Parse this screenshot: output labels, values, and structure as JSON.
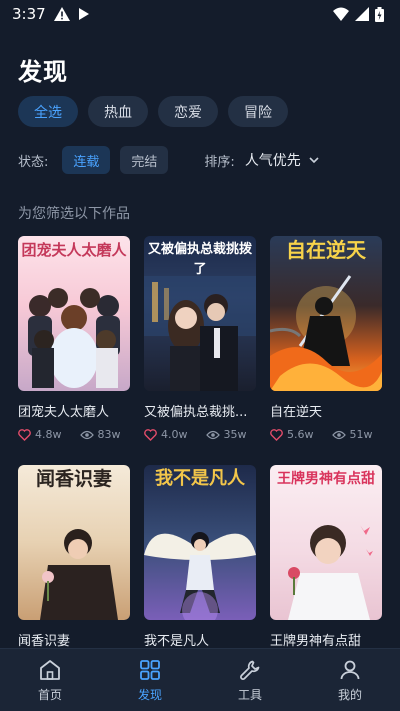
{
  "status_bar": {
    "time": "3:37"
  },
  "page": {
    "title": "发现"
  },
  "category_chips": [
    {
      "label": "全选",
      "active": true
    },
    {
      "label": "热血",
      "active": false
    },
    {
      "label": "恋爱",
      "active": false
    },
    {
      "label": "冒险",
      "active": false
    }
  ],
  "filters": {
    "status_label": "状态:",
    "status_options": [
      "连载",
      "完结"
    ],
    "sort_label": "排序:",
    "sort_value": "人气优先"
  },
  "section_label": "为您筛选以下作品",
  "books": [
    {
      "title": "团宠夫人太磨人",
      "cover_text": "团宠夫人太磨人",
      "likes": "4.8w",
      "views": "83w"
    },
    {
      "title": "又被偏执总裁挑...",
      "cover_text": "又被偏执总裁挑拨了",
      "likes": "4.0w",
      "views": "35w"
    },
    {
      "title": "自在逆天",
      "cover_text": "自在逆天",
      "likes": "5.6w",
      "views": "51w"
    },
    {
      "title": "闻香识妻",
      "cover_text": "闻香识妻",
      "likes": "",
      "views": ""
    },
    {
      "title": "我不是凡人",
      "cover_text": "我不是凡人",
      "likes": "",
      "views": ""
    },
    {
      "title": "王牌男神有点甜",
      "cover_text": "王牌男神有点甜",
      "likes": "",
      "views": ""
    }
  ],
  "bottom_nav": [
    {
      "label": "首页",
      "icon": "home-icon",
      "active": false
    },
    {
      "label": "发现",
      "icon": "grid-icon",
      "active": true
    },
    {
      "label": "工具",
      "icon": "wrench-icon",
      "active": false
    },
    {
      "label": "我的",
      "icon": "user-icon",
      "active": false
    }
  ],
  "colors": {
    "background": "#141c2b",
    "accent": "#4aa3ff",
    "chip": "#233044"
  }
}
